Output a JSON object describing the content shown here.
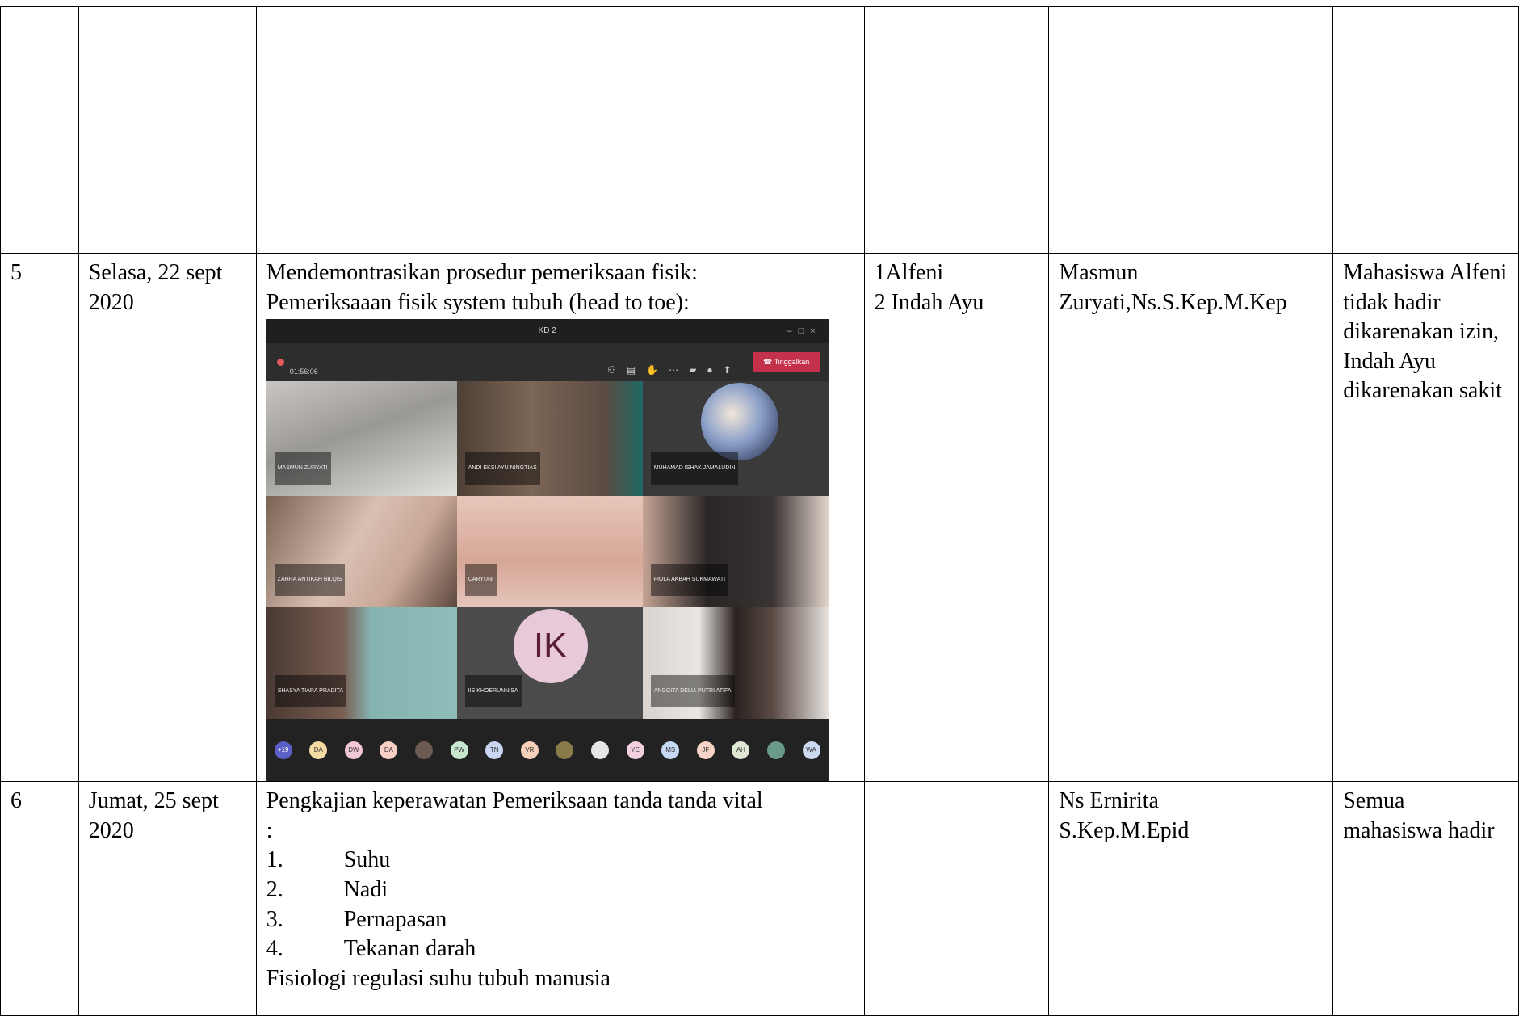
{
  "rows": [
    {
      "no": "",
      "date": [],
      "activity": [],
      "students": [],
      "lecturer": [],
      "note": []
    },
    {
      "no": "5",
      "date": [
        "Selasa, 22 sept",
        "2020"
      ],
      "activity": [
        "Mendemontrasikan prosedur pemeriksaan fisik:",
        "Pemeriksaaan fisik  system tubuh (head to toe):"
      ],
      "students": [
        "1Alfeni",
        "2 Indah Ayu"
      ],
      "lecturer": [
        "Masmun",
        "Zuryati,Ns.S.Kep.M.Kep"
      ],
      "note": "Mahasiswa Alfeni tidak hadir dikarenakan izin, Indah Ayu dikarenakan sakit"
    },
    {
      "no": "6",
      "date": [
        "Jumat, 25 sept",
        "2020"
      ],
      "activity_intro": [
        "Pengkajian  keperawatan Pemeriksaan tanda tanda vital",
        ":"
      ],
      "activity_list": [
        {
          "n": "1.",
          "t": "Suhu"
        },
        {
          "n": "2.",
          "t": "Nadi"
        },
        {
          "n": "3.",
          "t": "Pernapasan"
        },
        {
          "n": "4.",
          "t": "Tekanan darah"
        }
      ],
      "activity_outro": "Fisiologi regulasi suhu tubuh manusia",
      "students": [],
      "lecturer": [
        "Ns Ernirita",
        "S.Kep.M.Epid"
      ],
      "note": "Semua mahasiswa hadir"
    }
  ],
  "meeting": {
    "title": "KD 2",
    "timer": "01:56:06",
    "leave_label": "Tinggalkan",
    "avatar_initials": "IK",
    "participants": [
      "MASMUN ZURYATI",
      "ANDI EKSI AYU NINGTIAS",
      "MUHAMAD ISHAK JAMALUDIN",
      "ZAHRA ANTIKAH BILQIS",
      "CARYUNI",
      "FIOLA AKBAH SUKMAWATI",
      "SHASYA TIARA PRADITA",
      "IIS KHOERUNNISA",
      "ANGGITA DELIA PUTRI ATIFA"
    ],
    "chips": [
      {
        "label": "+19",
        "color": "#5b5fc7"
      },
      {
        "label": "DA",
        "color": "#f6dba4"
      },
      {
        "label": "DW",
        "color": "#f3c7d6"
      },
      {
        "label": "DA",
        "color": "#f8cfc4"
      },
      {
        "label": "",
        "color": "#6b5b50"
      },
      {
        "label": "PW",
        "color": "#c6e8cf"
      },
      {
        "label": "TN",
        "color": "#c9d6f2"
      },
      {
        "label": "VR",
        "color": "#f6d0b8"
      },
      {
        "label": "",
        "color": "#8a7a4a"
      },
      {
        "label": "",
        "color": "#e6e6e6"
      },
      {
        "label": "YE",
        "color": "#f4cfe0"
      },
      {
        "label": "MS",
        "color": "#c7daf3"
      },
      {
        "label": "JF",
        "color": "#f8d3c7"
      },
      {
        "label": "AH",
        "color": "#dfe8d2"
      },
      {
        "label": "",
        "color": "#6a9a8a"
      },
      {
        "label": "WA",
        "color": "#cdd9f1"
      }
    ]
  }
}
